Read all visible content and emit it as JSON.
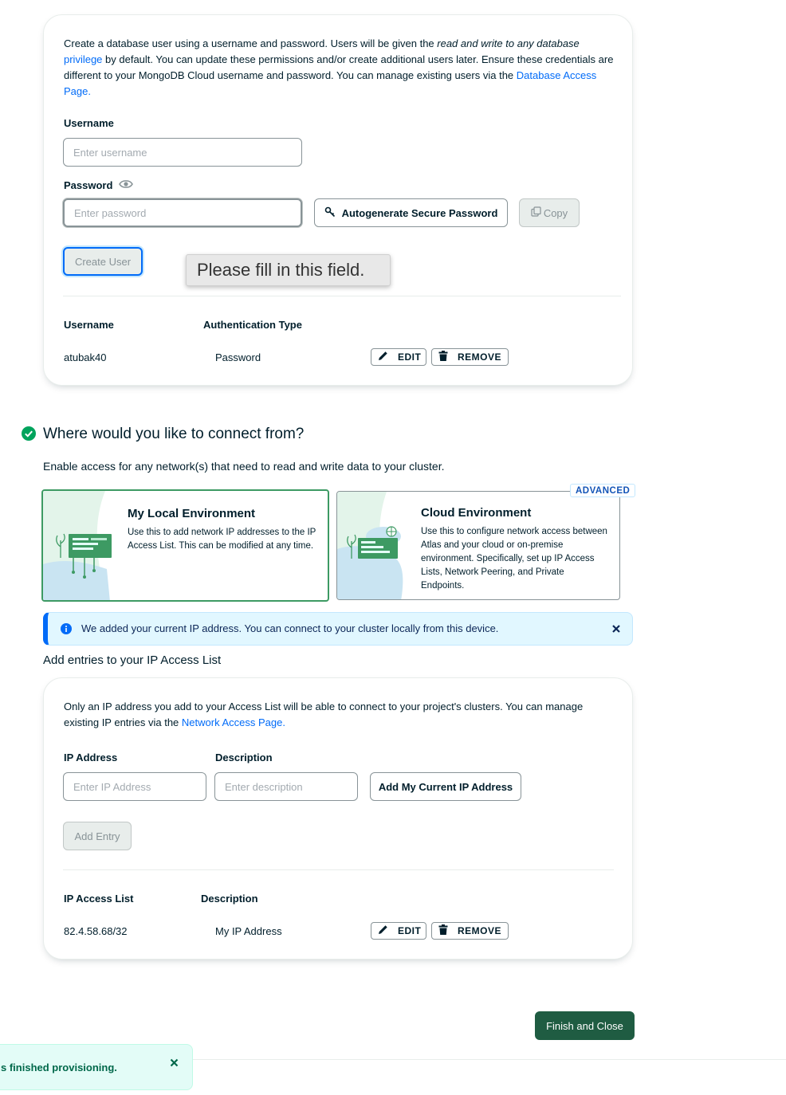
{
  "user_section": {
    "intro_part1": "Create a database user using a username and password. Users will be given the ",
    "intro_em": "read and write to any database",
    "intro_link1": "privilege",
    "intro_part2": " by default. You can update these permissions and/or create additional users later. Ensure these credentials are different to your MongoDB Cloud username and password. You can manage existing users via the ",
    "intro_link2": "Database Access Page.",
    "username_label": "Username",
    "username_placeholder": "Enter username",
    "username_value": "",
    "password_label": "Password",
    "password_placeholder": "Enter password",
    "password_value": "",
    "autogenerate_label": "Autogenerate Secure Password",
    "copy_label": "Copy",
    "create_user_label": "Create User",
    "validation_tooltip": "Please fill in this field.",
    "table_headers": [
      "Username",
      "Authentication Type"
    ],
    "users": [
      {
        "username": "atubak40",
        "auth_type": "Password",
        "edit_label": "EDIT",
        "remove_label": "REMOVE"
      }
    ]
  },
  "connect_section": {
    "title": "Where would you like to connect from?",
    "subtitle": "Enable access for any network(s) that need to read and write data to your cluster.",
    "local_env": {
      "title": "My Local Environment",
      "description": "Use this to add network IP addresses to the IP Access List. This can be modified at any time.",
      "selected": true
    },
    "cloud_env": {
      "badge": "ADVANCED",
      "title": "Cloud Environment",
      "description": "Use this to configure network access between Atlas and your cloud or on-premise environment. Specifically, set up IP Access Lists, Network Peering, and Private Endpoints.",
      "selected": false
    },
    "info_banner": "We added your current IP address. You can connect to your cluster locally from this device.",
    "ip_list_heading": "Add entries to your IP Access List"
  },
  "ip_section": {
    "intro_part1": "Only an IP address you add to your Access List will be able to connect to your project's clusters. You can manage existing IP entries via the ",
    "intro_link": "Network Access Page.",
    "ip_label": "IP Address",
    "ip_placeholder": "Enter IP Address",
    "desc_label": "Description",
    "desc_placeholder": "Enter description",
    "add_current_ip_label": "Add My Current IP Address",
    "add_entry_label": "Add Entry",
    "table_headers": [
      "IP Access List",
      "Description"
    ],
    "entries": [
      {
        "ip": "82.4.58.68/32",
        "description": "My IP Address",
        "edit_label": "EDIT",
        "remove_label": "REMOVE"
      }
    ]
  },
  "footer": {
    "finish_label": "Finish and Close",
    "toast_text": "s finished provisioning."
  },
  "colors": {
    "primary_green": "#00684a",
    "dark_green_button": "#1f5c42",
    "link_blue": "#016bf8",
    "info_blue_bg": "#e1f7ff",
    "info_blue_border": "#c3e7fe",
    "toast_green_bg": "#e3fcf7"
  },
  "icons": {
    "password_visibility": "eye-icon",
    "autogenerate": "key-icon",
    "copy": "copy-icon",
    "edit": "pencil-icon",
    "remove": "trash-icon",
    "section_status": "check-circle-icon",
    "info": "info-icon",
    "close": "close-icon"
  }
}
